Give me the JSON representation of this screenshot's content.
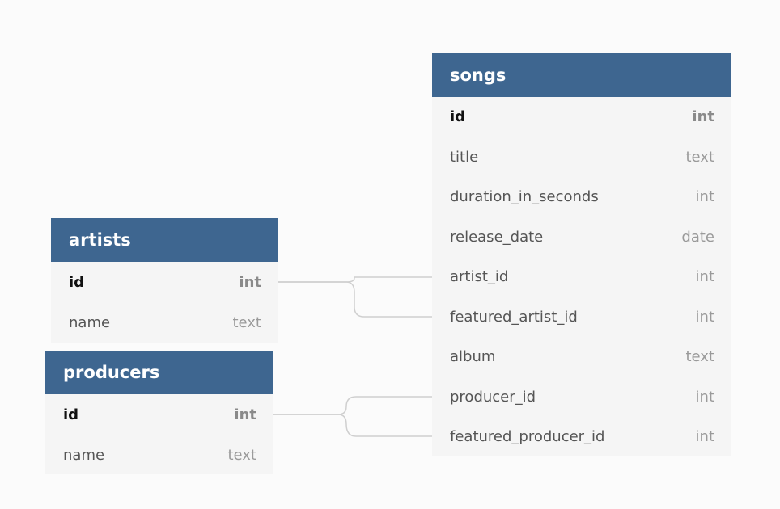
{
  "tables": {
    "songs": {
      "name": "songs",
      "columns": [
        {
          "name": "id",
          "type": "int",
          "pk": true
        },
        {
          "name": "title",
          "type": "text"
        },
        {
          "name": "duration_in_seconds",
          "type": "int"
        },
        {
          "name": "release_date",
          "type": "date"
        },
        {
          "name": "artist_id",
          "type": "int"
        },
        {
          "name": "featured_artist_id",
          "type": "int"
        },
        {
          "name": "album",
          "type": "text"
        },
        {
          "name": "producer_id",
          "type": "int"
        },
        {
          "name": "featured_producer_id",
          "type": "int"
        }
      ]
    },
    "artists": {
      "name": "artists",
      "columns": [
        {
          "name": "id",
          "type": "int",
          "pk": true
        },
        {
          "name": "name",
          "type": "text"
        }
      ]
    },
    "producers": {
      "name": "producers",
      "columns": [
        {
          "name": "id",
          "type": "int",
          "pk": true
        },
        {
          "name": "name",
          "type": "text"
        }
      ]
    }
  },
  "colors": {
    "header_bg": "#3e6690",
    "header_text": "#ffffff",
    "table_bg": "#f5f5f5",
    "connector": "#cfcfcf"
  }
}
